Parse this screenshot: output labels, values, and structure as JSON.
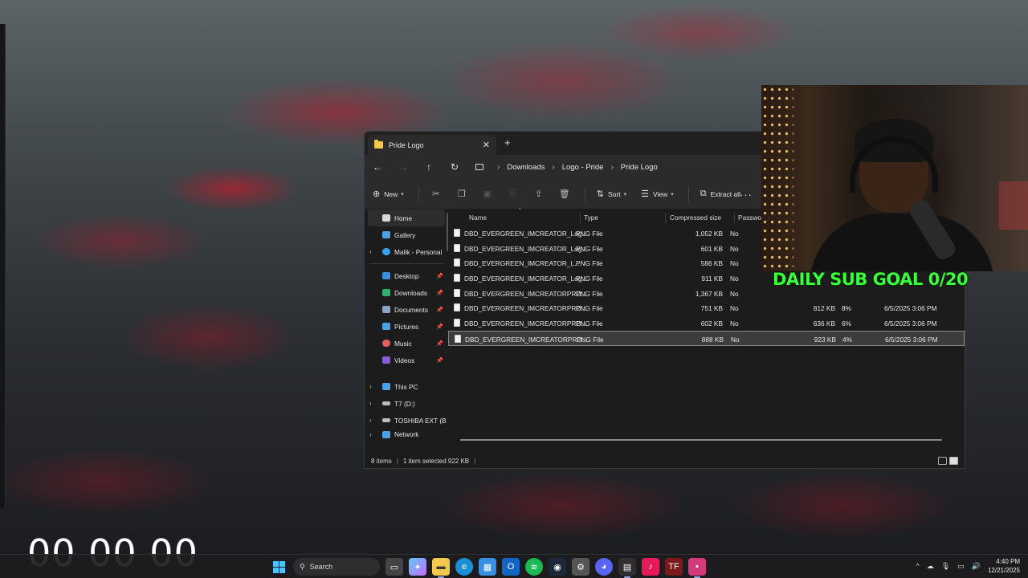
{
  "explorer": {
    "tab_title": "Pride Logo",
    "tab_close": "✕",
    "new_tab": "+",
    "nav": {
      "back": "←",
      "forward": "→",
      "up": "↑",
      "refresh": "↻"
    },
    "breadcrumbs": [
      "Downloads",
      "Logo - Pride",
      "Pride Logo"
    ],
    "commands": {
      "new": "New",
      "sort": "Sort",
      "view": "View",
      "extract_all": "Extract all",
      "more": "···"
    },
    "sidebar": {
      "home": "Home",
      "gallery": "Gallery",
      "onedrive": "Malik - Personal",
      "pinned": [
        {
          "label": "Desktop",
          "color": "#3a8fe0"
        },
        {
          "label": "Downloads",
          "color": "#2fb36a"
        },
        {
          "label": "Documents",
          "color": "#8aa4c8"
        },
        {
          "label": "Pictures",
          "color": "#4aa3e8"
        },
        {
          "label": "Music",
          "color": "#e0605a"
        },
        {
          "label": "Videos",
          "color": "#8a5ad8"
        }
      ],
      "drives": [
        {
          "label": "This PC"
        },
        {
          "label": "T7 (D:)"
        },
        {
          "label": "TOSHIBA EXT (B"
        },
        {
          "label": "Network"
        }
      ]
    },
    "columns": {
      "name": "Name",
      "type": "Type",
      "compressed_size": "Compressed size",
      "password": "Password"
    },
    "files": [
      {
        "name": "DBD_EVERGREEN_IMCREATOR_Log...",
        "type": "PNG File",
        "compressed": "1,052 KB",
        "password": "No",
        "size": "",
        "ratio": "",
        "date": ""
      },
      {
        "name": "DBD_EVERGREEN_IMCREATOR_Log...",
        "type": "PNG File",
        "compressed": "601 KB",
        "password": "No",
        "size": "",
        "ratio": "",
        "date": ""
      },
      {
        "name": "DBD_EVERGREEN_IMCREATOR_L...",
        "type": "PNG File",
        "compressed": "586 KB",
        "password": "No",
        "size": "",
        "ratio": "",
        "date": ""
      },
      {
        "name": "DBD_EVERGREEN_IMCREATOR_Log...",
        "type": "PNG File",
        "compressed": "911 KB",
        "password": "No",
        "size": "",
        "ratio": "",
        "date": ""
      },
      {
        "name": "DBD_EVERGREEN_IMCREATORPRO...",
        "type": "PNG File",
        "compressed": "1,367 KB",
        "password": "No",
        "size": "",
        "ratio": "",
        "date": ""
      },
      {
        "name": "DBD_EVERGREEN_IMCREATORPRO...",
        "type": "PNG File",
        "compressed": "751 KB",
        "password": "No",
        "size": "812 KB",
        "ratio": "8%",
        "date": "6/5/2025 3:06 PM"
      },
      {
        "name": "DBD_EVERGREEN_IMCREATORPRO...",
        "type": "PNG File",
        "compressed": "602 KB",
        "password": "No",
        "size": "636 KB",
        "ratio": "6%",
        "date": "6/5/2025 3:06 PM"
      },
      {
        "name": "DBD_EVERGREEN_IMCREATORPRO...",
        "type": "PNG File",
        "compressed": "888 KB",
        "password": "No",
        "size": "923 KB",
        "ratio": "4%",
        "date": "6/5/2025 3:06 PM"
      }
    ],
    "status": {
      "items": "8 items",
      "selected": "1 item selected  922 KB"
    }
  },
  "overlay": {
    "sub_goal": "DAILY SUB GOAL 0/20",
    "timer": "00 00 00"
  },
  "taskbar": {
    "search_placeholder": "Search",
    "time": "4:40 PM",
    "date": "12/21/2025"
  }
}
